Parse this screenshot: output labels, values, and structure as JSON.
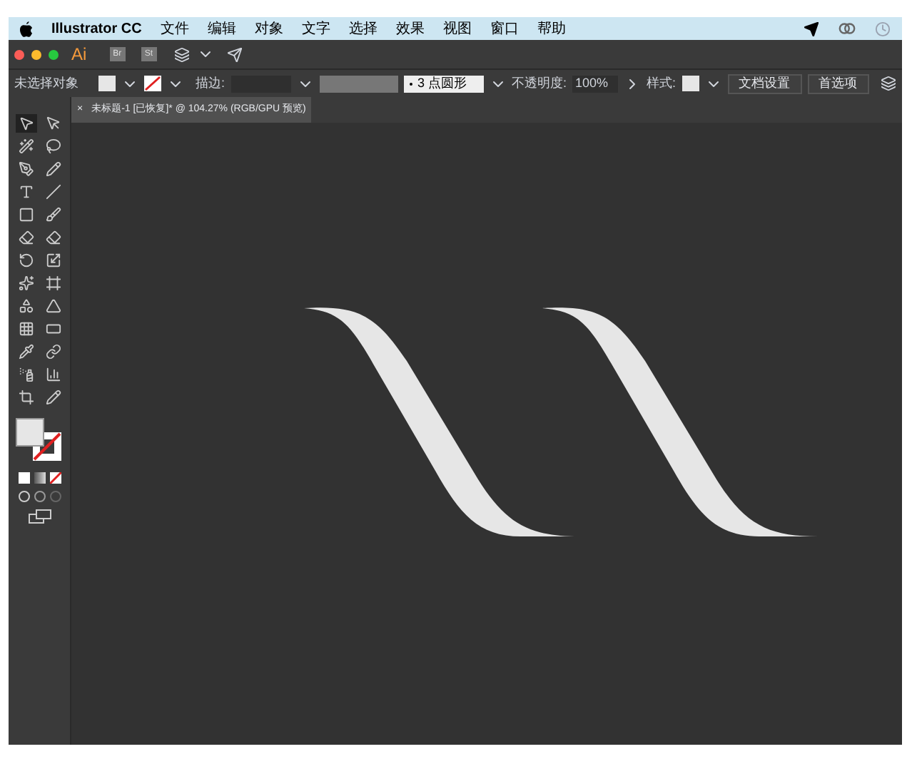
{
  "menu_bar": {
    "app_name": "Illustrator CC",
    "items": [
      "文件",
      "编辑",
      "对象",
      "文字",
      "选择",
      "效果",
      "视图",
      "窗口",
      "帮助"
    ]
  },
  "app_bar": {
    "logo": "Ai",
    "buttons": [
      "Br",
      "St"
    ]
  },
  "control_bar": {
    "selection": "未选择对象",
    "stroke_label": "描边:",
    "brush": "3 点圆形",
    "opacity_label": "不透明度:",
    "opacity": "100%",
    "style_label": "样式:",
    "buttons": [
      "文档设置",
      "首选项"
    ]
  },
  "document_tab": {
    "close": "×",
    "title": "未标题-1 [已恢复]* @ 104.27% (RGB/GPU 预览)"
  },
  "tools": [
    {
      "selected": true
    },
    {
      "selected": false
    },
    {
      "selected": false
    },
    {
      "selected": false
    },
    {
      "selected": false
    },
    {
      "selected": false
    },
    {
      "selected": false
    },
    {
      "selected": false
    },
    {
      "selected": false
    },
    {
      "selected": false
    },
    {
      "selected": false
    },
    {
      "selected": false
    },
    {
      "selected": false
    },
    {
      "selected": false
    },
    {
      "selected": false
    },
    {
      "selected": false
    },
    {
      "selected": false
    },
    {
      "selected": false
    },
    {
      "selected": false
    },
    {
      "selected": false
    },
    {
      "selected": false
    },
    {
      "selected": false
    },
    {
      "selected": false
    },
    {
      "selected": false
    },
    {
      "selected": false
    },
    {
      "selected": false
    }
  ]
}
